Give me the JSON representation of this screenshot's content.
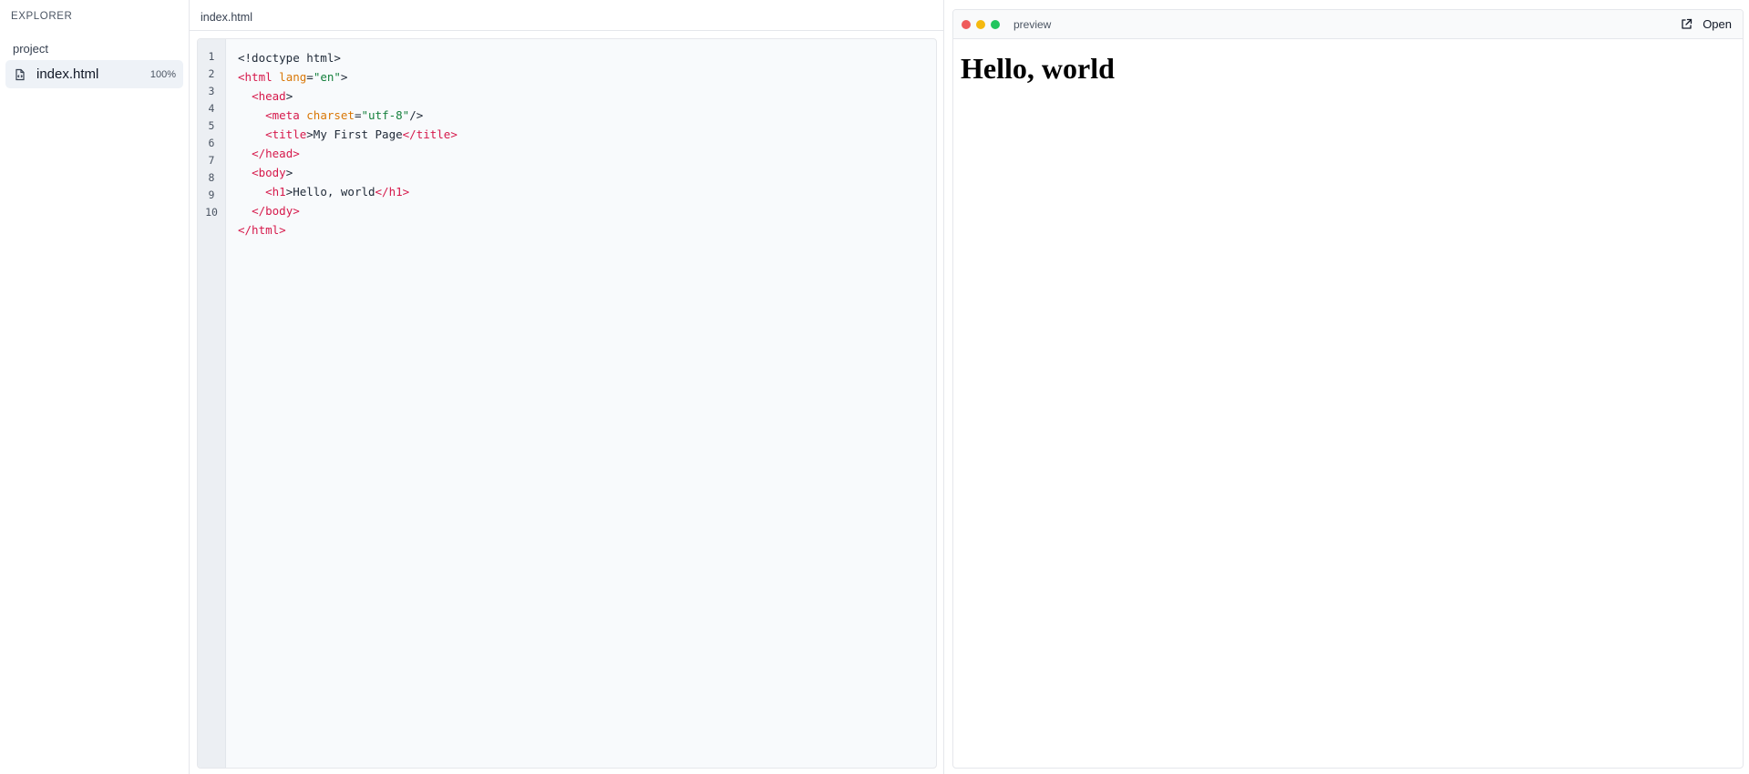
{
  "explorer": {
    "title": "EXPLORER",
    "folder": "project",
    "file": {
      "name": "index.html",
      "progress": "100%",
      "icon": "file-code-icon"
    }
  },
  "editor": {
    "tab": "index.html",
    "line_numbers": [
      "1",
      "2",
      "3",
      "4",
      "5",
      "6",
      "7",
      "8",
      "9",
      "10"
    ],
    "lines": [
      "<!doctype html>",
      "<html lang=\"en\">",
      "  <head>",
      "    <meta charset=\"utf-8\"/>",
      "    <title>My First Page</title>",
      "  </head>",
      "  <body>",
      "    <h1>Hello, world</h1>",
      "  </body>",
      "</html>"
    ]
  },
  "preview": {
    "title": "preview",
    "open_label": "Open",
    "open_icon": "external-link-icon",
    "heading": "Hello, world",
    "dots": {
      "close": "#ef5b5b",
      "minimize": "#f5b90f",
      "maximize": "#22c55e"
    }
  },
  "colors": {
    "tag": "#d6194b",
    "attribute": "#d97706",
    "string": "#15803d",
    "selected_file_bg": "#eef2f7"
  }
}
